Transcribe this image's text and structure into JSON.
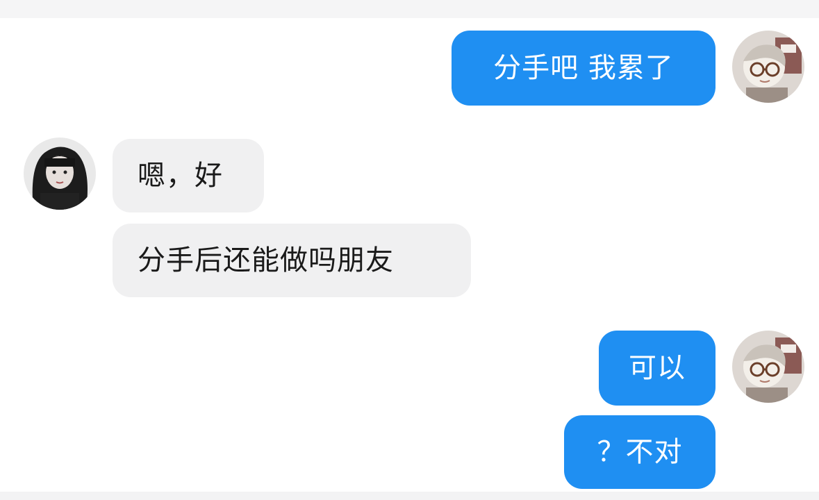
{
  "messages": [
    {
      "sender": "me",
      "text": "分手吧 我累了"
    },
    {
      "sender": "other",
      "text": "嗯，好"
    },
    {
      "sender": "other",
      "text": "分手后还能做吗朋友"
    },
    {
      "sender": "me",
      "text": "可以"
    },
    {
      "sender": "me",
      "text": "？不对"
    }
  ],
  "colors": {
    "my_bubble": "#1f8ff2",
    "other_bubble": "#f0f0f1",
    "my_text": "#ffffff",
    "other_text": "#1a1a1a"
  },
  "icons": {
    "my_avatar": "avatar-cartoon-glasses",
    "other_avatar": "avatar-dark-haired-girl"
  }
}
